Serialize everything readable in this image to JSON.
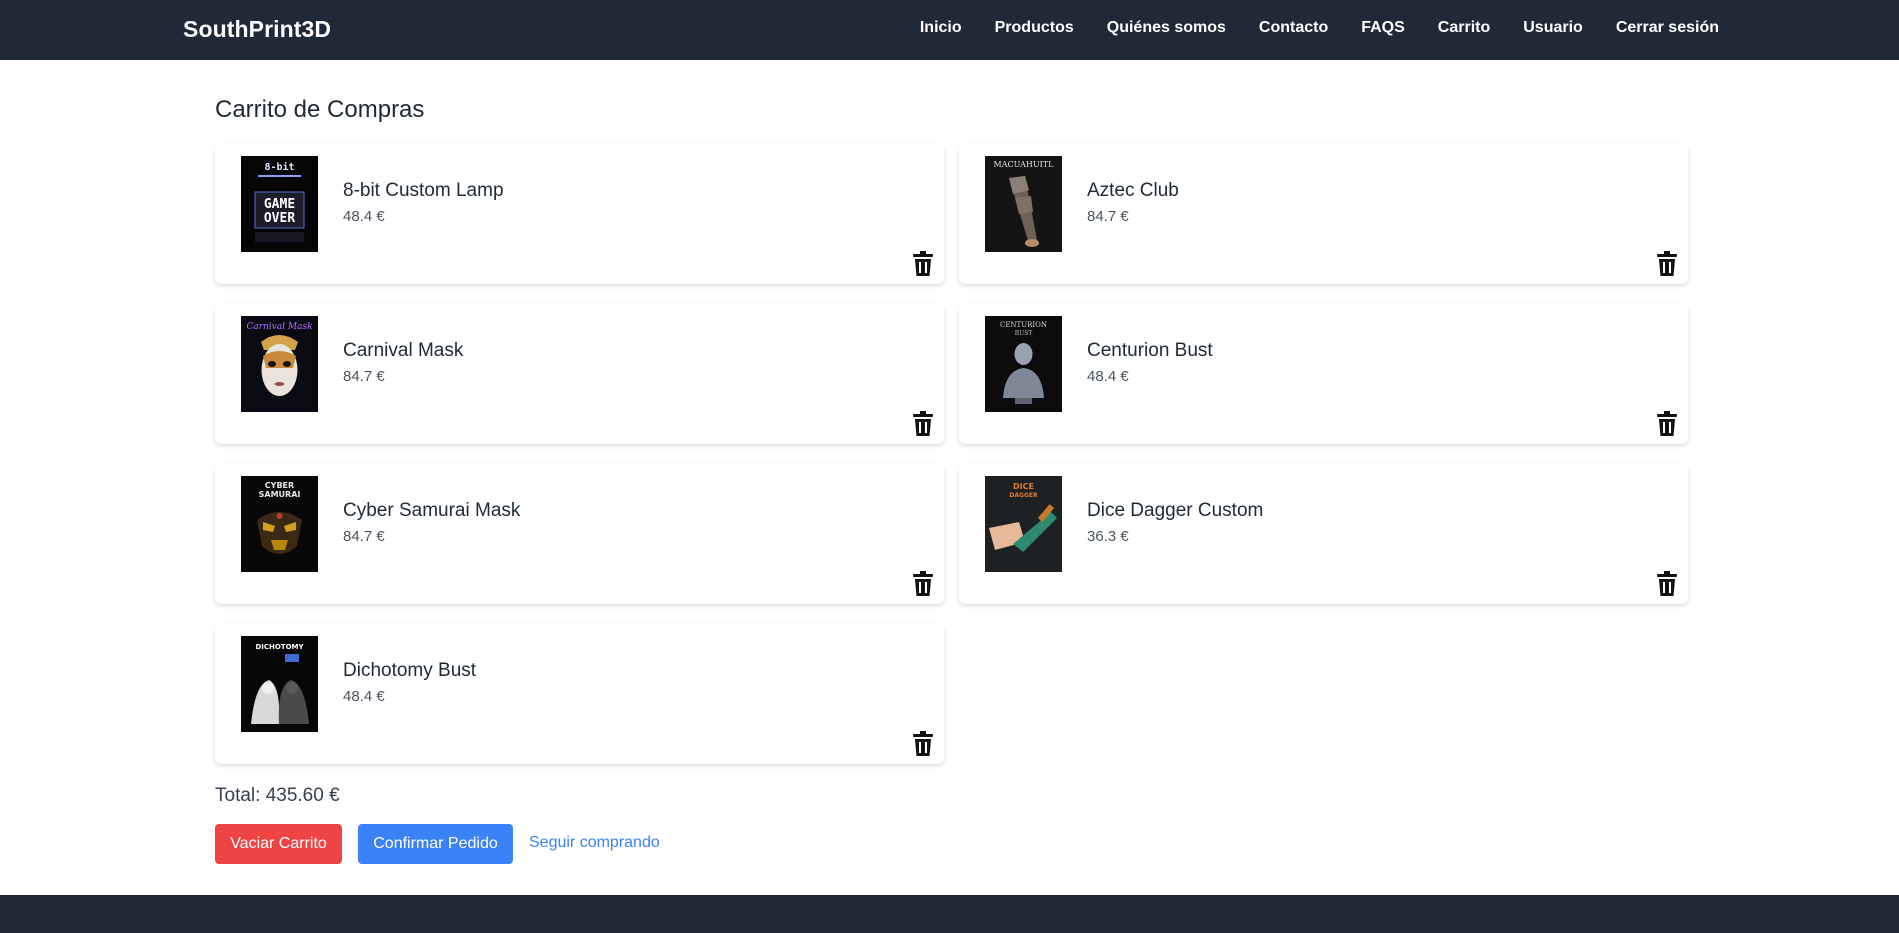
{
  "brand": "SouthPrint3D",
  "nav": [
    "Inicio",
    "Productos",
    "Quiénes somos",
    "Contacto",
    "FAQS",
    "Carrito",
    "Usuario",
    "Cerrar sesión"
  ],
  "page_title": "Carrito de Compras",
  "cart_items": [
    {
      "name": "8-bit Custom Lamp",
      "price": "48.4 €",
      "image_text": [
        "8-bit",
        "GAME",
        "OVER"
      ],
      "delete_icon": "trash-icon"
    },
    {
      "name": "Aztec Club",
      "price": "84.7 €",
      "image_text": [
        "MACUAHUITL"
      ],
      "delete_icon": "trash-icon"
    },
    {
      "name": "Carnival Mask",
      "price": "84.7 €",
      "image_text": [
        "Carnival Mask"
      ],
      "delete_icon": "trash-icon"
    },
    {
      "name": "Centurion Bust",
      "price": "48.4 €",
      "image_text": [
        "CENTURION",
        "BUST"
      ],
      "delete_icon": "trash-icon"
    },
    {
      "name": "Cyber Samurai Mask",
      "price": "84.7 €",
      "image_text": [
        "CYBER",
        "SAMURAI"
      ],
      "delete_icon": "trash-icon"
    },
    {
      "name": "Dice Dagger Custom",
      "price": "36.3 €",
      "image_text": [
        "DICE",
        "DAGGER"
      ],
      "delete_icon": "trash-icon"
    },
    {
      "name": "Dichotomy Bust",
      "price": "48.4 €",
      "image_text": [
        "DICHOTOMY"
      ],
      "delete_icon": "trash-icon"
    }
  ],
  "total": "Total: 435.60 €",
  "actions": {
    "clear": "Vaciar Carrito",
    "confirm": "Confirmar Pedido",
    "continue": "Seguir comprando"
  },
  "colors": {
    "navbar": "#1f2937",
    "danger": "#ef4444",
    "primary": "#3b82f6",
    "link": "#3b82f6"
  }
}
